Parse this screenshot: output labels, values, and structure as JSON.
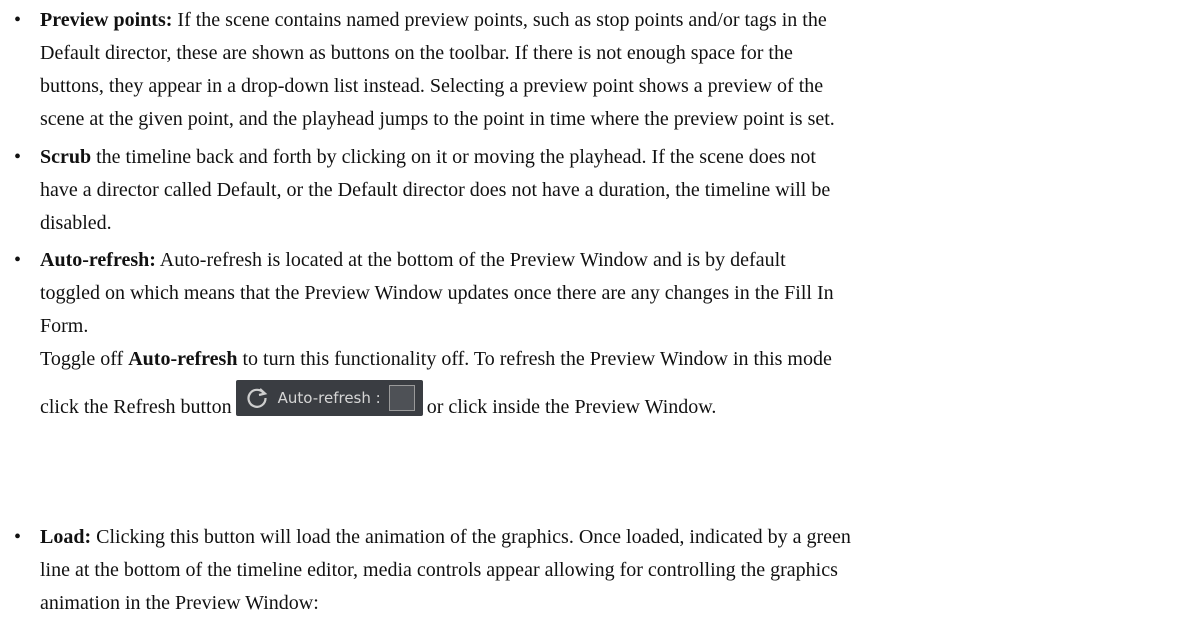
{
  "bullet_glyph": "•",
  "items": [
    {
      "label": "Preview points:",
      "lines": [
        " If the scene contains named preview points, such as stop points and/or tags in the",
        "Default director, these are shown as buttons on the toolbar. If there is not enough space for the",
        "buttons, they appear in a drop-down list instead. Selecting a preview point shows a preview of the",
        "scene at the given point, and the playhead jumps to the point in time where the preview point is set."
      ]
    },
    {
      "label": "Scrub",
      "lines": [
        " the timeline back and forth by clicking on it or moving the playhead. If the scene does not",
        "have a director called Default, or the Default director does not have a duration, the timeline will be",
        "disabled."
      ]
    },
    {
      "label": "Auto-refresh:",
      "lines": [
        " Auto-refresh is located at the bottom of the Preview Window and is by default",
        "toggled on which means that the Preview Window updates once there are any changes in the Fill In",
        "Form."
      ],
      "toggle_pre": "Toggle off ",
      "toggle_bold": "Auto-refresh",
      "toggle_post": " to turn this functionality off. To refresh the Preview Window in this mode",
      "click_pre": "click the Refresh button",
      "widget_label": "Auto-refresh :",
      "click_post": "or click inside the Preview Window."
    },
    {
      "label": "Load:",
      "lines": [
        " Clicking this button will load the animation of the graphics. Once loaded, indicated by a green",
        "line at the bottom of the timeline editor, media controls appear allowing for controlling the graphics",
        "animation in the Preview Window:"
      ]
    }
  ]
}
